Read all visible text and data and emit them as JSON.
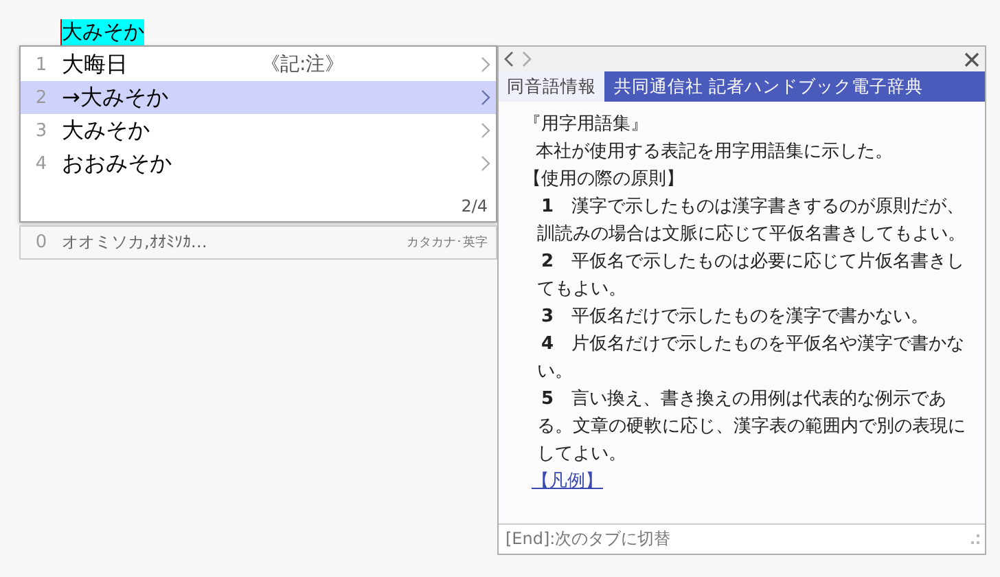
{
  "composition": {
    "text": "大みそか"
  },
  "candidates": [
    {
      "number": "1",
      "text": "大晦日",
      "note": "《記:注》",
      "selected": false
    },
    {
      "number": "2",
      "text": "→大みそか",
      "selected": true
    },
    {
      "number": "3",
      "text": "大みそか",
      "selected": false
    },
    {
      "number": "4",
      "text": "おおみそか",
      "selected": false
    }
  ],
  "page_indicator": "2/4",
  "extra_row": {
    "number": "0",
    "text": "オオミソカ,ｵｵﾐｿｶ…",
    "label": "カタカナ･英字"
  },
  "panel": {
    "tabs": [
      {
        "label": "同音語情報",
        "selected": false
      },
      {
        "label": "共同通信社 記者ハンドブック電子辞典",
        "selected": true
      }
    ],
    "content": [
      {
        "kind": "heading",
        "text": "『用字用語集』"
      },
      {
        "kind": "text",
        "text": "本社が使用する表記を用字用語集に示した。"
      },
      {
        "kind": "heading",
        "text": "【使用の際の原則】"
      },
      {
        "kind": "item",
        "text": "**1**　漢字で示したものは漢字書きするのが原則だが、訓読みの場合は文脈に応じて平仮名書きしてもよい。"
      },
      {
        "kind": "item",
        "text": "**2**　平仮名で示したものは必要に応じて片仮名書きしてもよい。"
      },
      {
        "kind": "item",
        "text": "**3**　平仮名だけで示したものを漢字で書かない。"
      },
      {
        "kind": "item",
        "text": "**4**　片仮名だけで示したものを平仮名や漢字で書かない。"
      },
      {
        "kind": "item",
        "text": "**5**　言い換え、書き換えの用例は代表的な例示である。文章の硬軟に応じ、漢字表の範囲内で別の表現にしてよい。"
      },
      {
        "kind": "link",
        "text": "【凡例】"
      }
    ],
    "footer": "[End]:次のタブに切替"
  }
}
